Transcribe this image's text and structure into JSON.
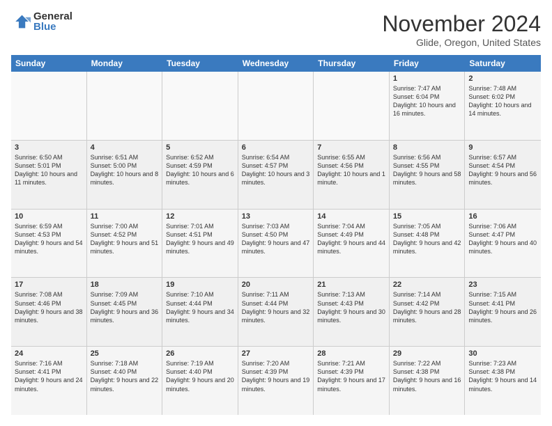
{
  "logo": {
    "general": "General",
    "blue": "Blue"
  },
  "title": "November 2024",
  "location": "Glide, Oregon, United States",
  "days_of_week": [
    "Sunday",
    "Monday",
    "Tuesday",
    "Wednesday",
    "Thursday",
    "Friday",
    "Saturday"
  ],
  "weeks": [
    [
      {
        "day": "",
        "info": ""
      },
      {
        "day": "",
        "info": ""
      },
      {
        "day": "",
        "info": ""
      },
      {
        "day": "",
        "info": ""
      },
      {
        "day": "",
        "info": ""
      },
      {
        "day": "1",
        "info": "Sunrise: 7:47 AM\nSunset: 6:04 PM\nDaylight: 10 hours\nand 16 minutes."
      },
      {
        "day": "2",
        "info": "Sunrise: 7:48 AM\nSunset: 6:02 PM\nDaylight: 10 hours\nand 14 minutes."
      }
    ],
    [
      {
        "day": "3",
        "info": "Sunrise: 6:50 AM\nSunset: 5:01 PM\nDaylight: 10 hours\nand 11 minutes."
      },
      {
        "day": "4",
        "info": "Sunrise: 6:51 AM\nSunset: 5:00 PM\nDaylight: 10 hours\nand 8 minutes."
      },
      {
        "day": "5",
        "info": "Sunrise: 6:52 AM\nSunset: 4:59 PM\nDaylight: 10 hours\nand 6 minutes."
      },
      {
        "day": "6",
        "info": "Sunrise: 6:54 AM\nSunset: 4:57 PM\nDaylight: 10 hours\nand 3 minutes."
      },
      {
        "day": "7",
        "info": "Sunrise: 6:55 AM\nSunset: 4:56 PM\nDaylight: 10 hours\nand 1 minute."
      },
      {
        "day": "8",
        "info": "Sunrise: 6:56 AM\nSunset: 4:55 PM\nDaylight: 9 hours\nand 58 minutes."
      },
      {
        "day": "9",
        "info": "Sunrise: 6:57 AM\nSunset: 4:54 PM\nDaylight: 9 hours\nand 56 minutes."
      }
    ],
    [
      {
        "day": "10",
        "info": "Sunrise: 6:59 AM\nSunset: 4:53 PM\nDaylight: 9 hours\nand 54 minutes."
      },
      {
        "day": "11",
        "info": "Sunrise: 7:00 AM\nSunset: 4:52 PM\nDaylight: 9 hours\nand 51 minutes."
      },
      {
        "day": "12",
        "info": "Sunrise: 7:01 AM\nSunset: 4:51 PM\nDaylight: 9 hours\nand 49 minutes."
      },
      {
        "day": "13",
        "info": "Sunrise: 7:03 AM\nSunset: 4:50 PM\nDaylight: 9 hours\nand 47 minutes."
      },
      {
        "day": "14",
        "info": "Sunrise: 7:04 AM\nSunset: 4:49 PM\nDaylight: 9 hours\nand 44 minutes."
      },
      {
        "day": "15",
        "info": "Sunrise: 7:05 AM\nSunset: 4:48 PM\nDaylight: 9 hours\nand 42 minutes."
      },
      {
        "day": "16",
        "info": "Sunrise: 7:06 AM\nSunset: 4:47 PM\nDaylight: 9 hours\nand 40 minutes."
      }
    ],
    [
      {
        "day": "17",
        "info": "Sunrise: 7:08 AM\nSunset: 4:46 PM\nDaylight: 9 hours\nand 38 minutes."
      },
      {
        "day": "18",
        "info": "Sunrise: 7:09 AM\nSunset: 4:45 PM\nDaylight: 9 hours\nand 36 minutes."
      },
      {
        "day": "19",
        "info": "Sunrise: 7:10 AM\nSunset: 4:44 PM\nDaylight: 9 hours\nand 34 minutes."
      },
      {
        "day": "20",
        "info": "Sunrise: 7:11 AM\nSunset: 4:44 PM\nDaylight: 9 hours\nand 32 minutes."
      },
      {
        "day": "21",
        "info": "Sunrise: 7:13 AM\nSunset: 4:43 PM\nDaylight: 9 hours\nand 30 minutes."
      },
      {
        "day": "22",
        "info": "Sunrise: 7:14 AM\nSunset: 4:42 PM\nDaylight: 9 hours\nand 28 minutes."
      },
      {
        "day": "23",
        "info": "Sunrise: 7:15 AM\nSunset: 4:41 PM\nDaylight: 9 hours\nand 26 minutes."
      }
    ],
    [
      {
        "day": "24",
        "info": "Sunrise: 7:16 AM\nSunset: 4:41 PM\nDaylight: 9 hours\nand 24 minutes."
      },
      {
        "day": "25",
        "info": "Sunrise: 7:18 AM\nSunset: 4:40 PM\nDaylight: 9 hours\nand 22 minutes."
      },
      {
        "day": "26",
        "info": "Sunrise: 7:19 AM\nSunset: 4:40 PM\nDaylight: 9 hours\nand 20 minutes."
      },
      {
        "day": "27",
        "info": "Sunrise: 7:20 AM\nSunset: 4:39 PM\nDaylight: 9 hours\nand 19 minutes."
      },
      {
        "day": "28",
        "info": "Sunrise: 7:21 AM\nSunset: 4:39 PM\nDaylight: 9 hours\nand 17 minutes."
      },
      {
        "day": "29",
        "info": "Sunrise: 7:22 AM\nSunset: 4:38 PM\nDaylight: 9 hours\nand 16 minutes."
      },
      {
        "day": "30",
        "info": "Sunrise: 7:23 AM\nSunset: 4:38 PM\nDaylight: 9 hours\nand 14 minutes."
      }
    ]
  ]
}
